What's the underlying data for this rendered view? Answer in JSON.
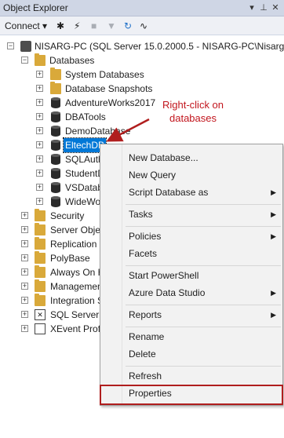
{
  "window": {
    "title": "Object Explorer",
    "pin_icon": "pin-icon",
    "dropdown_icon": "dropdown-icon",
    "close_icon": "close-icon"
  },
  "toolbar": {
    "connect_label": "Connect",
    "connect_arrow": "▾"
  },
  "tree": {
    "server": "NISARG-PC (SQL Server 15.0.2000.5 - NISARG-PC\\Nisarg)",
    "databases": "Databases",
    "db_items": [
      "System Databases",
      "Database Snapshots",
      "AdventureWorks2017",
      "DBATools",
      "DemoDatabase",
      "EltechDB",
      "SQLAuth",
      "StudentD",
      "VSDatab",
      "WideWo"
    ],
    "server_items": [
      "Security",
      "Server Objec",
      "Replication",
      "PolyBase",
      "Always On H",
      "Managemen",
      "Integration S",
      "SQL Server A",
      "XEvent Profi"
    ]
  },
  "annotation": {
    "text": "Right-click on databases",
    "color": "#c2151d"
  },
  "context_menu": {
    "items": [
      {
        "label": "New Database...",
        "submenu": false
      },
      {
        "label": "New Query",
        "submenu": false
      },
      {
        "label": "Script Database as",
        "submenu": true
      },
      {
        "label": "Tasks",
        "submenu": true
      },
      {
        "label": "Policies",
        "submenu": true
      },
      {
        "label": "Facets",
        "submenu": false
      },
      {
        "label": "Start PowerShell",
        "submenu": false
      },
      {
        "label": "Azure Data Studio",
        "submenu": true
      },
      {
        "label": "Reports",
        "submenu": true
      },
      {
        "label": "Rename",
        "submenu": false
      },
      {
        "label": "Delete",
        "submenu": false
      },
      {
        "label": "Refresh",
        "submenu": false
      },
      {
        "label": "Properties",
        "submenu": false
      }
    ],
    "highlighted_item": "Properties"
  },
  "colors": {
    "selection": "#0078d7",
    "highlight_box": "#b01e1e"
  }
}
